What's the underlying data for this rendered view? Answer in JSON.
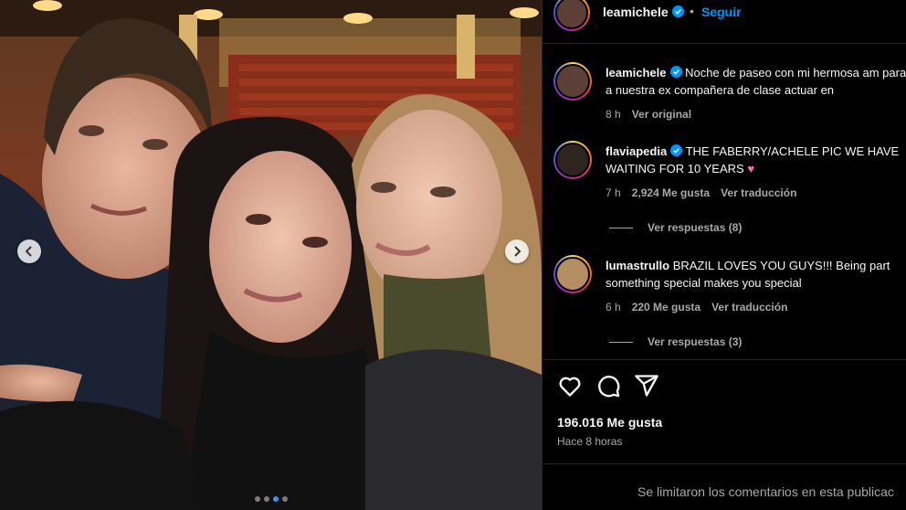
{
  "media": {
    "carousel_count": 4,
    "carousel_active": 2
  },
  "header": {
    "username": "leamichele",
    "separator": "•",
    "follow_label": "Seguir"
  },
  "comments": [
    {
      "username": "leamichele",
      "text": "Noche de paseo con mi hermosa am para ver a nuestra ex compañera de clase actuar en",
      "time": "8 h",
      "translate": "Ver original"
    },
    {
      "username": "flaviapedia",
      "text": "THE FABERRY/ACHELE PIC WE HAVE WAITING FOR 10 YEARS",
      "emoji": "♥",
      "time": "7 h",
      "likes": "2,924 Me gusta",
      "translate": "Ver traducción",
      "replies": "Ver respuestas (8)"
    },
    {
      "username": "lumastrullo",
      "text": "BRAZIL LOVES YOU GUYS!!! Being part something special makes you special",
      "time": "6 h",
      "likes": "220 Me gusta",
      "translate": "Ver traducción",
      "replies": "Ver respuestas (3)"
    }
  ],
  "footer": {
    "likes": "196.016 Me gusta",
    "time": "Hace 8 horas",
    "comments_limited": "Se limitaron los comentarios en esta publicac"
  },
  "icons": {
    "like": "heart-icon",
    "comment": "comment-icon",
    "share": "share-icon",
    "verified": "verified-badge-icon",
    "prev": "chevron-left-icon",
    "next": "chevron-right-icon"
  },
  "colors": {
    "background": "#000000",
    "link_blue": "#0095f6",
    "verified_blue": "#0095f6",
    "secondary_text": "#a8a8a8",
    "divider": "#262626",
    "pink_heart": "#ff6bb5"
  }
}
